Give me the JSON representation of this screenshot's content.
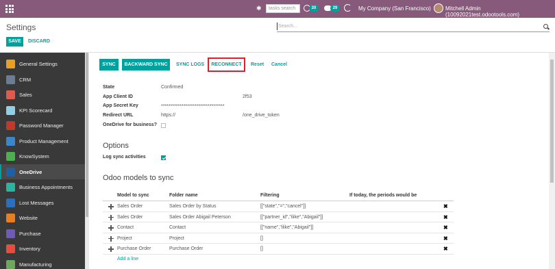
{
  "topbar": {
    "search_placeholder": "tasks search",
    "activity_count": "20",
    "messages_count": "29",
    "company": "My Company (San Francisco)",
    "user": "Mitchell Admin (10092021test.odootools.com)"
  },
  "control_panel": {
    "title": "Settings",
    "search_placeholder": "Search...",
    "save_label": "SAVE",
    "discard_label": "DISCARD"
  },
  "sidebar": {
    "items": [
      {
        "label": "General Settings",
        "color": "#e8a020"
      },
      {
        "label": "CRM",
        "color": "#6b7c93"
      },
      {
        "label": "Sales",
        "color": "#e05a4e"
      },
      {
        "label": "KPI Scorecard",
        "color": "#8fd0e8"
      },
      {
        "label": "Password Manager",
        "color": "#c0392b"
      },
      {
        "label": "Product Management",
        "color": "#3a86c8"
      },
      {
        "label": "KnowSystem",
        "color": "#4caf50"
      },
      {
        "label": "OneDrive",
        "color": "#1e5fa8"
      },
      {
        "label": "Business Appointments",
        "color": "#2bb3a0"
      },
      {
        "label": "Lost Messages",
        "color": "#2c6fbd"
      },
      {
        "label": "Website",
        "color": "#e67e22"
      },
      {
        "label": "Purchase",
        "color": "#6d5bb5"
      },
      {
        "label": "Inventory",
        "color": "#e74c3c"
      },
      {
        "label": "Manufacturing",
        "color": "#6fa85d"
      }
    ],
    "active_index": 7
  },
  "actions": {
    "sync": "SYNC",
    "backward_sync": "BACKWARD SYNC",
    "sync_logs": "SYNC LOGS",
    "reconnect": "RECONNECT",
    "reset": "Reset",
    "cancel": "Cancel"
  },
  "fields": {
    "state_label": "State",
    "state_value": "Confirmed",
    "client_id_label": "App Client ID",
    "client_id_value": "2f53",
    "secret_label": "App Secret Key",
    "secret_value": "**********************************",
    "redirect_label": "Redirect URL",
    "redirect_value_left": "https://",
    "redirect_value_right": "/one_drive_token",
    "business_label": "OneDrive for business?",
    "business_checked": false
  },
  "options": {
    "heading": "Options",
    "log_label": "Log sync activities",
    "log_checked": true
  },
  "models": {
    "heading": "Odoo models to sync",
    "columns": [
      "Model to sync",
      "Folder name",
      "Filtering",
      "If today, the periods would be"
    ],
    "rows": [
      {
        "model": "Sales Order",
        "folder": "Sales Order by Status",
        "filter": "[[\"state\",\"=\",\"cancel\"]]"
      },
      {
        "model": "Sales Order",
        "folder": "Sales Order Abigail Peterson",
        "filter": "[[\"partner_id\",\"ilike\",\"Abigail\"]]"
      },
      {
        "model": "Contact",
        "folder": "Contact",
        "filter": "[[\"name\",\"ilike\",\"Abigail\"]]"
      },
      {
        "model": "Project",
        "folder": "Project",
        "filter": "[]"
      },
      {
        "model": "Purchase Order",
        "folder": "Purchase Order",
        "filter": "[]"
      }
    ],
    "delete_icon": "✖",
    "add_line": "Add a line"
  }
}
